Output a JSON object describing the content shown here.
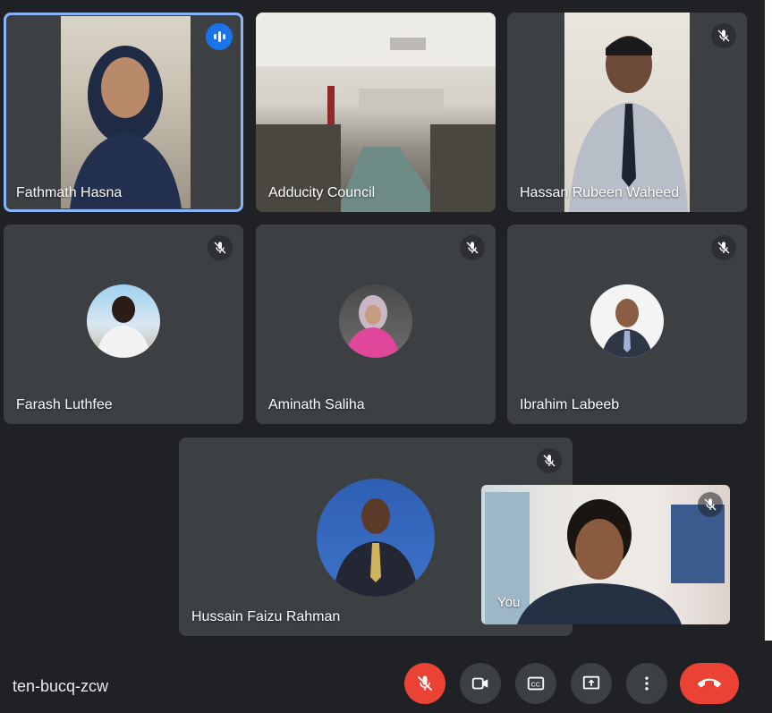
{
  "meeting": {
    "code": "ten-bucq-zcw"
  },
  "participants": [
    {
      "name": "Fathmath Hasna",
      "status": "speaking"
    },
    {
      "name": "Adducity Council",
      "status": "unmuted"
    },
    {
      "name": "Hassan Rubeen Waheed",
      "status": "muted"
    },
    {
      "name": "Farash Luthfee",
      "status": "muted"
    },
    {
      "name": "Aminath Saliha",
      "status": "muted"
    },
    {
      "name": "Ibrahim Labeeb",
      "status": "muted"
    },
    {
      "name": "Hussain Faizu Rahman",
      "status": "muted"
    }
  ],
  "self_view": {
    "label": "You",
    "status": "muted"
  },
  "controls": {
    "mic": "mic-off-icon",
    "camera": "videocam-icon",
    "captions": "closed-captions-icon",
    "present": "present-screen-icon",
    "more": "more-options-icon",
    "leave": "end-call-icon"
  },
  "colors": {
    "background": "#202124",
    "tile": "#3c4043",
    "active_border": "#8ab4f8",
    "speaking_badge": "#1a73e8",
    "danger": "#ea4335"
  }
}
